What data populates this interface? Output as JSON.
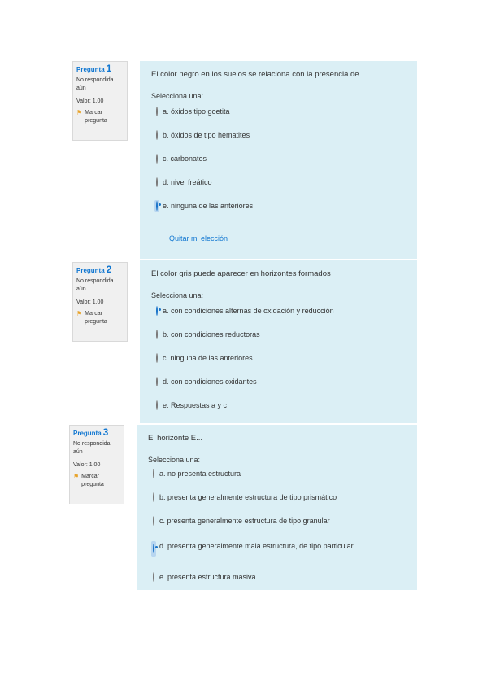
{
  "questions": [
    {
      "label": "Pregunta",
      "number": "1",
      "status": "No respondida aún",
      "value": "Valor: 1,00",
      "flag": "Marcar pregunta",
      "text": "El color negro en los suelos se relaciona con la presencia de",
      "prompt": "Selecciona una:",
      "options": [
        {
          "text": "a. óxidos tipo goetita",
          "checked": false
        },
        {
          "text": "b. óxidos de tipo hematites",
          "checked": false
        },
        {
          "text": "c. carbonatos",
          "checked": false
        },
        {
          "text": "d. nivel freático",
          "checked": false
        },
        {
          "text": "e. ninguna de las anteriores",
          "checked": true
        }
      ],
      "clear": "Quitar mi elección"
    },
    {
      "label": "Pregunta",
      "number": "2",
      "status": "No respondida aún",
      "value": "Valor: 1,00",
      "flag": "Marcar pregunta",
      "text": "El color gris puede aparecer en horizontes formados",
      "prompt": "Selecciona una:",
      "options": [
        {
          "text": "a. con condiciones alternas de oxidación y reducción",
          "checked": true
        },
        {
          "text": "b. con condiciones reductoras",
          "checked": false
        },
        {
          "text": "c. ninguna de las anteriores",
          "checked": false
        },
        {
          "text": "d. con condiciones oxidantes",
          "checked": false
        },
        {
          "text": "e. Respuestas a y c",
          "checked": false
        }
      ]
    },
    {
      "label": "Pregunta",
      "number": "3",
      "status": "No respondida aún",
      "value": "Valor: 1,00",
      "flag": "Marcar pregunta",
      "text": "El horizonte E...",
      "prompt": "Selecciona una:",
      "options": [
        {
          "text": "a. no presenta estructura",
          "checked": false
        },
        {
          "text": "b. presenta generalmente estructura de tipo prismático",
          "checked": false
        },
        {
          "text": "c. presenta generalmente estructura de tipo granular",
          "checked": false
        },
        {
          "text": "d. presenta generalmente mala estructura, de tipo particular",
          "checked": true
        },
        {
          "text": "e. presenta estructura masiva",
          "checked": false
        }
      ]
    }
  ]
}
